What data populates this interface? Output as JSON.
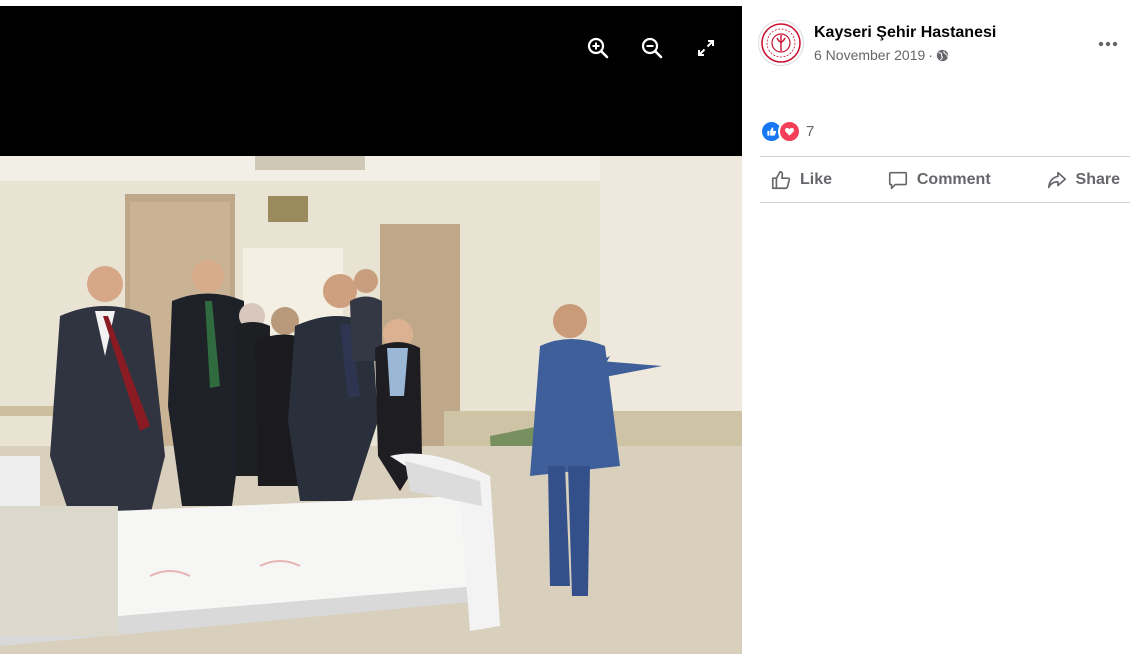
{
  "photo_viewer": {
    "toolbar": {
      "zoom_in_icon": "zoom-in-icon",
      "zoom_out_icon": "zoom-out-icon",
      "fullscreen_icon": "fullscreen-icon"
    }
  },
  "post": {
    "page_name": "Kayseri Şehir Hastanesi",
    "date": "6 November 2019",
    "separator": "·",
    "privacy_icon": "globe-icon",
    "more_icon": "more-options-icon",
    "reactions": {
      "icons": [
        "like-reaction-icon",
        "love-reaction-icon"
      ],
      "count": "7"
    },
    "actions": {
      "like_label": "Like",
      "comment_label": "Comment",
      "share_label": "Share"
    }
  },
  "colors": {
    "like_blue": "#1877f2",
    "love_red": "#f33e58",
    "secondary_text": "#65676b",
    "divider": "#ced0d4"
  }
}
